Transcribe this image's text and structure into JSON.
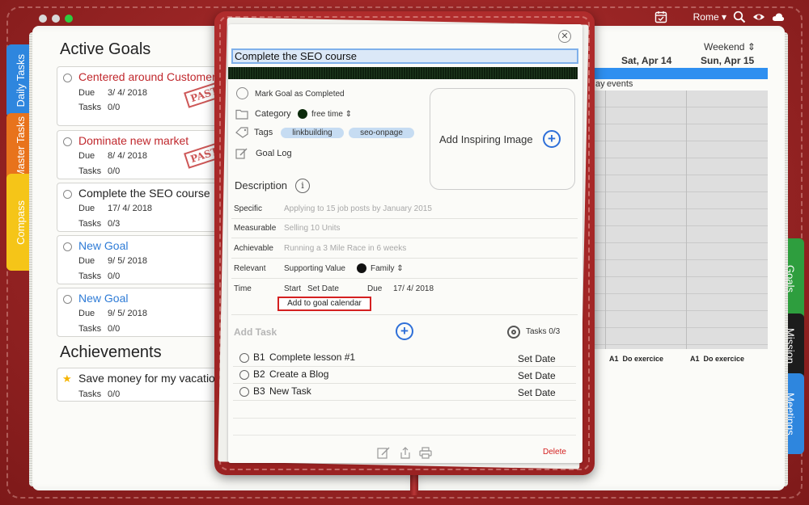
{
  "menubar": {
    "location": "Rome ▾",
    "icons": [
      "calendar-check-icon",
      "search-icon",
      "eye-icon",
      "cloud-icon"
    ]
  },
  "left_tabs": [
    "Daily Tasks",
    "Master Tasks",
    "Compass"
  ],
  "right_tabs": [
    "Goals",
    "Mission",
    "Meetings"
  ],
  "active_goals": {
    "title": "Active Goals",
    "goals": [
      {
        "title": "Centered around Customer",
        "due_label": "Due",
        "due": "3/ 4/ 2018",
        "tasks_label": "Tasks",
        "tasks": "0/0",
        "stamp": "PAST",
        "color": "#c0282d"
      },
      {
        "title": "Dominate new market",
        "due_label": "Due",
        "due": "8/ 4/ 2018",
        "tasks_label": "Tasks",
        "tasks": "0/0",
        "stamp": "PAST",
        "color": "#c0282d"
      },
      {
        "title": "Complete the SEO course",
        "due_label": "Due",
        "due": "17/ 4/ 2018",
        "tasks_label": "Tasks",
        "tasks": "0/3",
        "stamp": "",
        "color": "#222222"
      },
      {
        "title": "New Goal",
        "due_label": "Due",
        "due": "9/ 5/ 2018",
        "tasks_label": "Tasks",
        "tasks": "0/0",
        "stamp": "",
        "color": "#2e7bd6"
      },
      {
        "title": "New Goal",
        "due_label": "Due",
        "due": "9/ 5/ 2018",
        "tasks_label": "Tasks",
        "tasks": "0/0",
        "stamp": "",
        "color": "#2e7bd6"
      }
    ]
  },
  "achievements": {
    "title": "Achievements",
    "items": [
      {
        "title": "Save money for my vacation",
        "tasks_label": "Tasks",
        "tasks": "0/0"
      }
    ]
  },
  "calendar": {
    "mode": "Weekend ⇕",
    "days": [
      "Sat, Apr 14",
      "Sun, Apr 15"
    ],
    "events_label": "events",
    "events_prefix": "ay",
    "tasks": [
      {
        "code": "A1",
        "name": "Do exercice"
      },
      {
        "code": "A1",
        "name": "Do exercice"
      }
    ]
  },
  "modal": {
    "title_value": "Complete the SEO course",
    "mark_completed": "Mark Goal as Completed",
    "category_label": "Category",
    "category_value": "free time ⇕",
    "tags_label": "Tags",
    "tags": [
      "linkbuilding",
      "seo-onpage"
    ],
    "goal_log": "Goal Log",
    "add_image": "Add Inspiring Image",
    "description": "Description",
    "fields": {
      "specific_label": "Specific",
      "specific_placeholder": "Applying to 15 job posts by January 2015",
      "measurable_label": "Measurable",
      "measurable_placeholder": "Selling 10 Units",
      "achievable_label": "Achievable",
      "achievable_placeholder": "Running a 3 Mile Race in 6 weeks",
      "relevant_label": "Relevant",
      "relevant_value": "Supporting Value",
      "relevant_option": "Family ⇕",
      "time_label": "Time",
      "start_label": "Start",
      "start_value": "Set Date",
      "due_label": "Due",
      "due_value": "17/ 4/ 2018"
    },
    "add_to_calendar": "Add to goal calendar",
    "add_task": "Add Task",
    "tasks_count": "Tasks 0/3",
    "tasks": [
      {
        "code": "B1",
        "name": "Complete lesson #1",
        "date": "Set Date"
      },
      {
        "code": "B2",
        "name": "Create a Blog",
        "date": "Set Date"
      },
      {
        "code": "B3",
        "name": "New Task",
        "date": "Set Date"
      }
    ],
    "delete": "Delete"
  }
}
